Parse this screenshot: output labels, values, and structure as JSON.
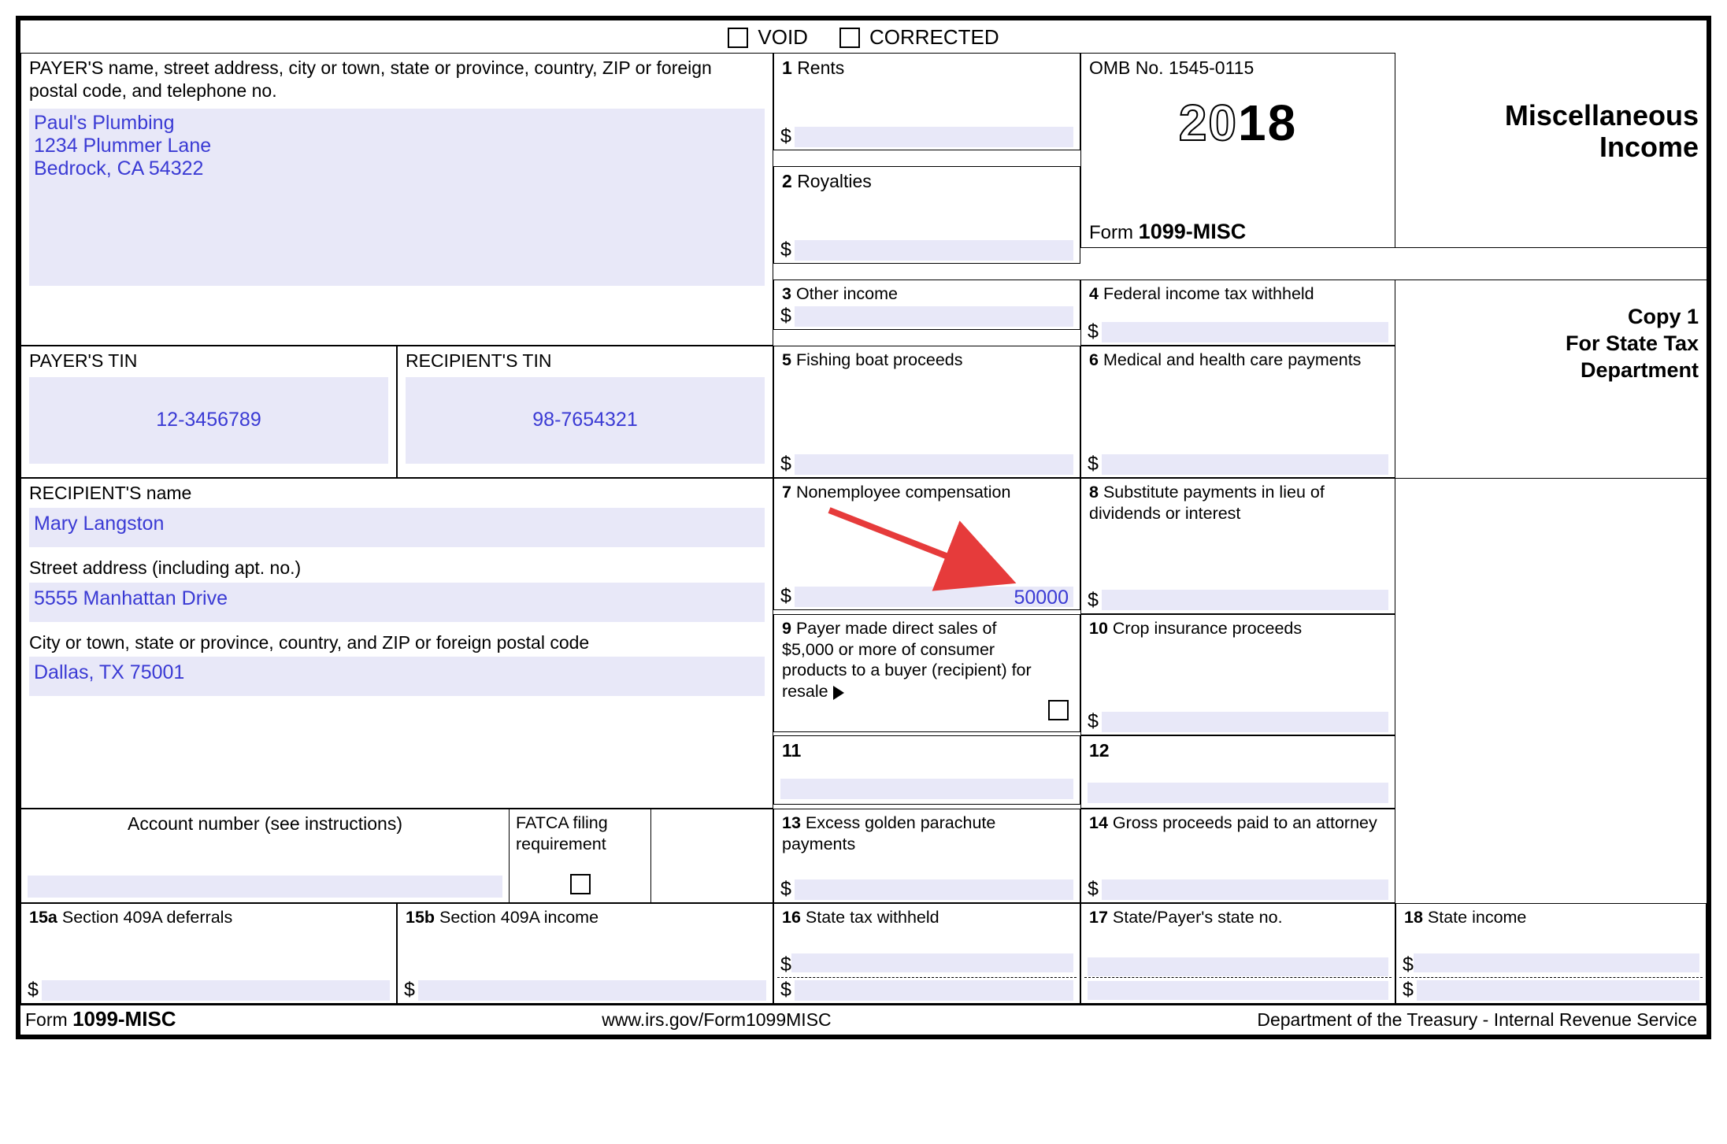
{
  "header": {
    "void_label": "VOID",
    "corrected_label": "CORRECTED"
  },
  "meta": {
    "omb": "OMB No. 1545-0115",
    "year_a": "20",
    "year_b": "18",
    "form_prefix": "Form ",
    "form_name": "1099-MISC",
    "title_l1": "Miscellaneous",
    "title_l2": "Income",
    "copy_l1": "Copy 1",
    "copy_l2": "For State Tax",
    "copy_l3": "Department"
  },
  "payer": {
    "label": "PAYER'S name, street address, city or town, state or province, country, ZIP or foreign postal code, and telephone no.",
    "line1": "Paul's Plumbing",
    "line2": "1234 Plummer Lane",
    "line3": "Bedrock, CA 54322"
  },
  "tin": {
    "payer_label": "PAYER'S TIN",
    "payer_value": "12-3456789",
    "recipient_label": "RECIPIENT'S TIN",
    "recipient_value": "98-7654321"
  },
  "recipient": {
    "name_label": "RECIPIENT'S name",
    "name_value": "Mary Langston",
    "street_label": "Street address (including apt. no.)",
    "street_value": "5555 Manhattan Drive",
    "city_label": "City or town, state or province, country, and ZIP or foreign postal code",
    "city_value": "Dallas, TX 75001"
  },
  "acct": {
    "label": "Account number (see instructions)",
    "fatca_label": "FATCA filing requirement"
  },
  "boxes": {
    "b1": {
      "num": "1",
      "label": "Rents",
      "value": ""
    },
    "b2": {
      "num": "2",
      "label": "Royalties",
      "value": ""
    },
    "b3": {
      "num": "3",
      "label": "Other income",
      "value": ""
    },
    "b4": {
      "num": "4",
      "label": "Federal income tax withheld",
      "value": ""
    },
    "b5": {
      "num": "5",
      "label": "Fishing boat proceeds",
      "value": ""
    },
    "b6": {
      "num": "6",
      "label": "Medical and health care payments",
      "value": ""
    },
    "b7": {
      "num": "7",
      "label": "Nonemployee compensation",
      "value": "50000"
    },
    "b8": {
      "num": "8",
      "label": "Substitute payments in lieu of dividends or interest",
      "value": ""
    },
    "b9": {
      "num": "9",
      "label": "Payer made direct sales of $5,000 or more of consumer products to a buyer (recipient) for resale"
    },
    "b10": {
      "num": "10",
      "label": "Crop insurance proceeds",
      "value": ""
    },
    "b11": {
      "num": "11",
      "label": ""
    },
    "b12": {
      "num": "12",
      "label": ""
    },
    "b13": {
      "num": "13",
      "label": "Excess golden parachute payments",
      "value": ""
    },
    "b14": {
      "num": "14",
      "label": "Gross proceeds paid to an attorney",
      "value": ""
    },
    "b15a": {
      "num": "15a",
      "label": "Section 409A deferrals",
      "value": ""
    },
    "b15b": {
      "num": "15b",
      "label": "Section 409A income",
      "value": ""
    },
    "b16": {
      "num": "16",
      "label": "State tax withheld",
      "value1": "",
      "value2": ""
    },
    "b17": {
      "num": "17",
      "label": "State/Payer's state no.",
      "value1": "",
      "value2": ""
    },
    "b18": {
      "num": "18",
      "label": "State income",
      "value1": "",
      "value2": ""
    }
  },
  "footer": {
    "form_prefix": "Form ",
    "form_name": "1099-MISC",
    "url": "www.irs.gov/Form1099MISC",
    "dept": "Department of the Treasury - Internal Revenue Service"
  }
}
